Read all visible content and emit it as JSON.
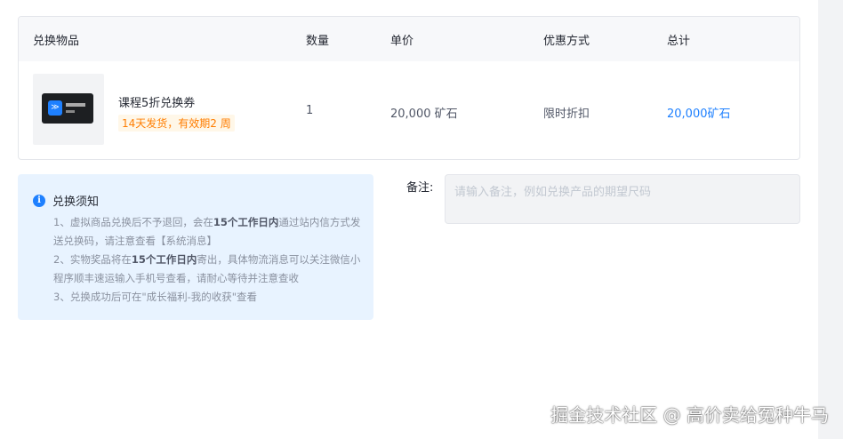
{
  "table": {
    "headers": [
      "兑换物品",
      "数量",
      "单价",
      "优惠方式",
      "总计"
    ],
    "row": {
      "name": "课程5折兑换券",
      "tag": "14天发货，有效期2 周",
      "quantity": "1",
      "unit_price": "20,000 矿石",
      "discount": "限时折扣",
      "total": "20,000矿石"
    }
  },
  "notice": {
    "title": "兑换须知",
    "items": [
      {
        "a": "1、虚拟商品兑换后不予退回，会在",
        "b": "15个工作日内",
        "c": "通过站内信方式发送兑换码，请注意查看【系统消息】"
      },
      {
        "a": "2、实物奖品将在",
        "b": "15个工作日内",
        "c": "寄出，具体物流消息可以关注微信小程序顺丰速运输入手机号查看，请耐心等待并注意查收"
      },
      {
        "a": "3、兑换成功后可在\"成长福利-我的收获\"查看",
        "b": "",
        "c": ""
      }
    ]
  },
  "remark": {
    "label": "备注:",
    "placeholder": "请输入备注，例如兑换产品的期望尺码",
    "value": ""
  },
  "watermark": "掘金技术社区 @ 高价卖给冤种牛马",
  "colors": {
    "accent": "#1e80ff",
    "tag": "#ff7d00",
    "notice_bg": "#e8f3ff"
  }
}
